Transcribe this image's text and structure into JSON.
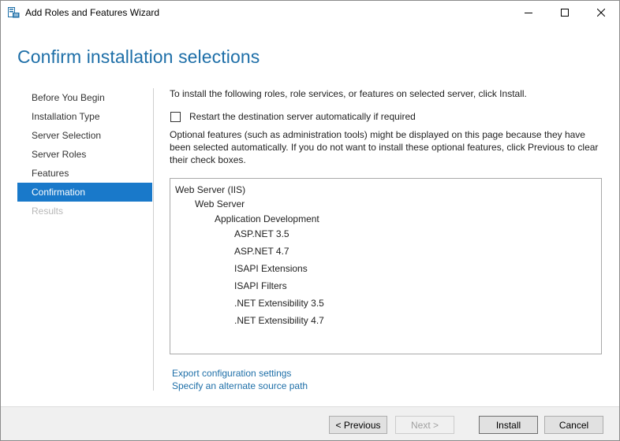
{
  "window": {
    "title": "Add Roles and Features Wizard",
    "controls": {
      "minimize": "minimize-icon",
      "maximize": "maximize-icon",
      "close": "close-icon"
    }
  },
  "header": {
    "title": "Confirm installation selections"
  },
  "nav": {
    "items": [
      {
        "label": "Before You Begin",
        "state": "normal"
      },
      {
        "label": "Installation Type",
        "state": "normal"
      },
      {
        "label": "Server Selection",
        "state": "normal"
      },
      {
        "label": "Server Roles",
        "state": "normal"
      },
      {
        "label": "Features",
        "state": "normal"
      },
      {
        "label": "Confirmation",
        "state": "active"
      },
      {
        "label": "Results",
        "state": "disabled"
      }
    ]
  },
  "main": {
    "intro": "To install the following roles, role services, or features on selected server, click Install.",
    "restart_label": "Restart the destination server automatically if required",
    "restart_checked": false,
    "optional_text": "Optional features (such as administration tools) might be displayed on this page because they have been selected automatically. If you do not want to install these optional features, click Previous to clear their check boxes.",
    "selections": [
      {
        "label": "Web Server (IIS)",
        "level": 0
      },
      {
        "label": "Web Server",
        "level": 1
      },
      {
        "label": "Application Development",
        "level": 2
      },
      {
        "label": "ASP.NET 3.5",
        "level": 3
      },
      {
        "label": "ASP.NET 4.7",
        "level": 3
      },
      {
        "label": "ISAPI Extensions",
        "level": 3
      },
      {
        "label": "ISAPI Filters",
        "level": 3
      },
      {
        "label": ".NET Extensibility 3.5",
        "level": 3
      },
      {
        "label": ".NET Extensibility 4.7",
        "level": 3
      }
    ],
    "links": {
      "export": "Export configuration settings",
      "alternate_source": "Specify an alternate source path"
    }
  },
  "footer": {
    "previous": "< Previous",
    "next": "Next >",
    "install": "Install",
    "cancel": "Cancel"
  },
  "colors": {
    "accent": "#1979ca",
    "title": "#1e6fa8",
    "link": "#1e6fa8"
  }
}
